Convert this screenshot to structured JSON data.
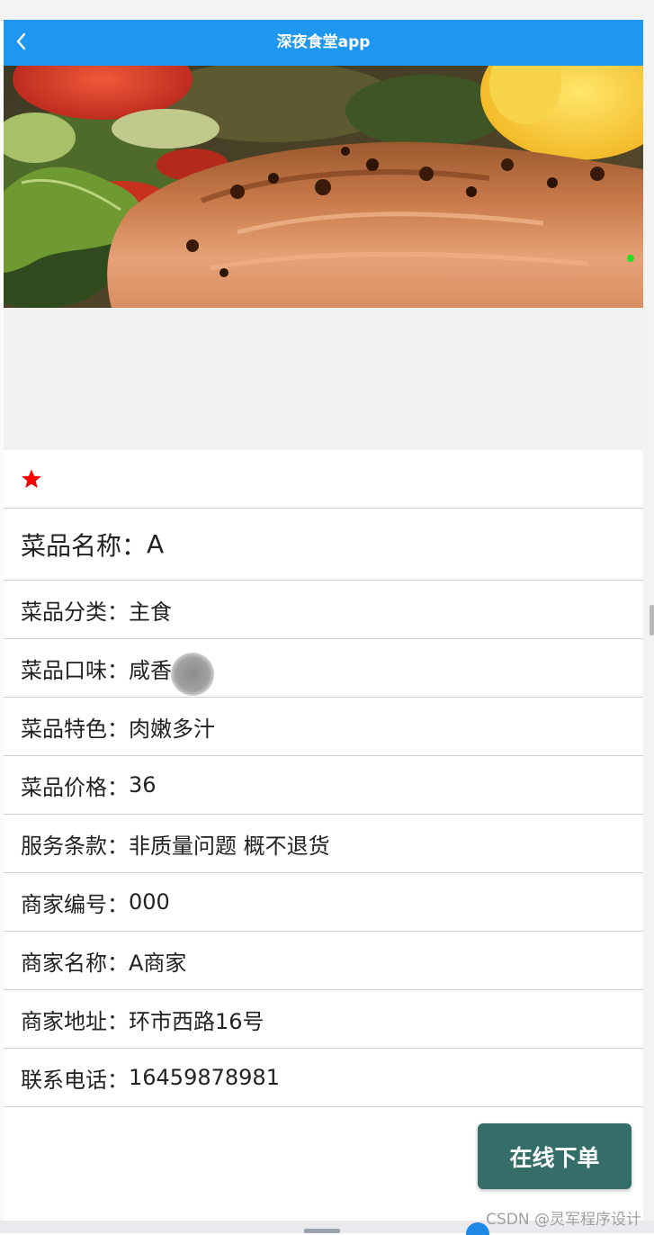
{
  "navbar": {
    "title": "深夜食堂app",
    "back_icon": "chevron-left-icon"
  },
  "favorite": {
    "icon": "star-icon",
    "color": "#ff0000"
  },
  "details": {
    "name": {
      "label": "菜品名称：",
      "value": "A"
    },
    "rows": [
      {
        "label": "菜品分类：",
        "value": "主食"
      },
      {
        "label": "菜品口味：",
        "value": "咸香"
      },
      {
        "label": "菜品特色：",
        "value": "肉嫩多汁"
      },
      {
        "label": "菜品价格：",
        "value": "36"
      },
      {
        "label": "服务条款：",
        "value": "非质量问题 概不退货"
      },
      {
        "label": "商家编号：",
        "value": "000"
      },
      {
        "label": "商家名称：",
        "value": "A商家"
      },
      {
        "label": "商家地址：",
        "value": "环市西路16号"
      },
      {
        "label": "联系电话：",
        "value": "16459878981"
      }
    ]
  },
  "actions": {
    "order_label": "在线下单"
  },
  "watermark": "CSDN @灵军程序设计",
  "colors": {
    "navbar": "#1e97f0",
    "order_button": "#356e68",
    "star": "#ff0000"
  }
}
